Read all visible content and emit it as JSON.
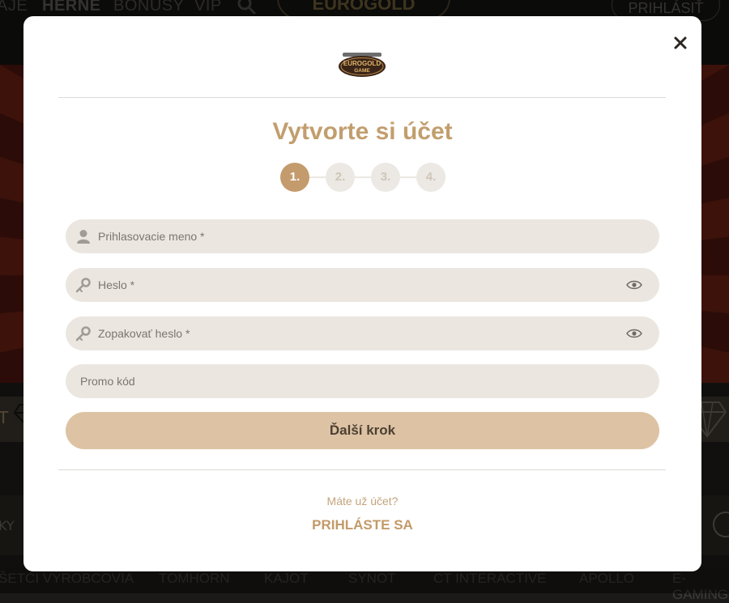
{
  "background": {
    "nav": {
      "items": [
        "AJE",
        "HERNE",
        "BONUSY",
        "VIP"
      ],
      "active_item": "HERNE",
      "logo_text": "EUROGOLD",
      "login_label": "PRIHLÁSIŤ"
    },
    "strip_text": "T",
    "row2_text": "KY",
    "providers": [
      "ŠETCI VÝROBCOVIA",
      "TOMHORN",
      "KAJOT",
      "SYNOT",
      "CT INTERACTIVE",
      "APOLLO",
      "E-GAMING"
    ]
  },
  "modal": {
    "logo": {
      "line1": "EUROGOLD",
      "line2": "GAME"
    },
    "title": "Vytvorte si účet",
    "steps": [
      "1.",
      "2.",
      "3.",
      "4."
    ],
    "active_step": 1,
    "fields": {
      "username": {
        "placeholder": "Prihlasovacie meno *",
        "value": "",
        "icon": "user-icon"
      },
      "password": {
        "placeholder": "Heslo *",
        "value": "",
        "icon": "key-icon"
      },
      "password_repeat": {
        "placeholder": "Zopakovať heslo *",
        "value": "",
        "icon": "key-icon"
      },
      "promo": {
        "placeholder": "Promo kód",
        "value": ""
      }
    },
    "next_button": "Ďalší krok",
    "have_account": "Máte už účet?",
    "login_link": "PRIHLÁSTE SA"
  },
  "colors": {
    "accent": "#c29e6e",
    "button": "#ddc3a4",
    "field_bg": "#ebe6e0"
  }
}
